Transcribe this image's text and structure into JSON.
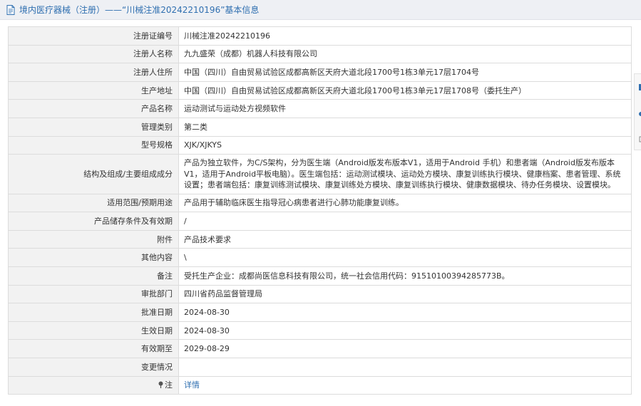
{
  "header": {
    "title": "境内医疗器械（注册）——“川械注准20242210196”基本信息",
    "icon": "document-icon"
  },
  "rows": [
    {
      "key": "reg-number",
      "label": "注册证编号",
      "value": "川械注准20242210196"
    },
    {
      "key": "registrant-name",
      "label": "注册人名称",
      "value": "九九盛荣（成都）机器人科技有限公司"
    },
    {
      "key": "registrant-address",
      "label": "注册人住所",
      "value": "中国（四川）自由贸易试验区成都高新区天府大道北段1700号1栋3单元17层1704号"
    },
    {
      "key": "production-address",
      "label": "生产地址",
      "value": "中国（四川）自由贸易试验区成都高新区天府大道北段1700号1栋3单元17层1708号（委托生产）"
    },
    {
      "key": "product-name",
      "label": "产品名称",
      "value": "运动测试与运动处方视频软件"
    },
    {
      "key": "management-class",
      "label": "管理类别",
      "value": "第二类"
    },
    {
      "key": "model-spec",
      "label": "型号规格",
      "value": "XJK/XJKYS"
    },
    {
      "key": "structure",
      "label": "结构及组成/主要组成成分",
      "value": "产品为独立软件，为C/S架构，分为医生端（Android版发布版本V1，适用于Android 手机）和患者端（Android版发布版本V1，适用于Android平板电脑）。医生端包括：运动测试模块、运动处方模块、康复训练执行模块、健康档案、患者管理、系统设置；患者端包括：康复训练测试模块、康复训练处方模块、康复训练执行模块、健康数据模块、待办任务模块、设置模块。"
    },
    {
      "key": "scope",
      "label": "适用范围/预期用途",
      "value": "产品用于辅助临床医生指导冠心病患者进行心肺功能康复训练。"
    },
    {
      "key": "storage",
      "label": "产品储存条件及有效期",
      "value": "/"
    },
    {
      "key": "attachment",
      "label": "附件",
      "value": "产品技术要求"
    },
    {
      "key": "other",
      "label": "其他内容",
      "value": "\\"
    },
    {
      "key": "remarks",
      "label": "备注",
      "value": "受托生产企业：成都尚医信息科技有限公司，统一社会信用代码：91510100394285773B。"
    },
    {
      "key": "approval-dept",
      "label": "审批部门",
      "value": "四川省药品监督管理局"
    },
    {
      "key": "approval-date",
      "label": "批准日期",
      "value": "2024-08-30"
    },
    {
      "key": "effective-date",
      "label": "生效日期",
      "value": "2024-08-30"
    },
    {
      "key": "expiry-date",
      "label": "有效期至",
      "value": "2029-08-29"
    },
    {
      "key": "change",
      "label": "变更情况",
      "value": ""
    }
  ],
  "note": {
    "label": "注",
    "link": "详情",
    "icon": "pin-icon"
  },
  "colors": {
    "header_bg": "#eef0f4",
    "label_bg": "#f2f2f2",
    "link": "#2f6fb0",
    "border": "#dcdcdc"
  }
}
